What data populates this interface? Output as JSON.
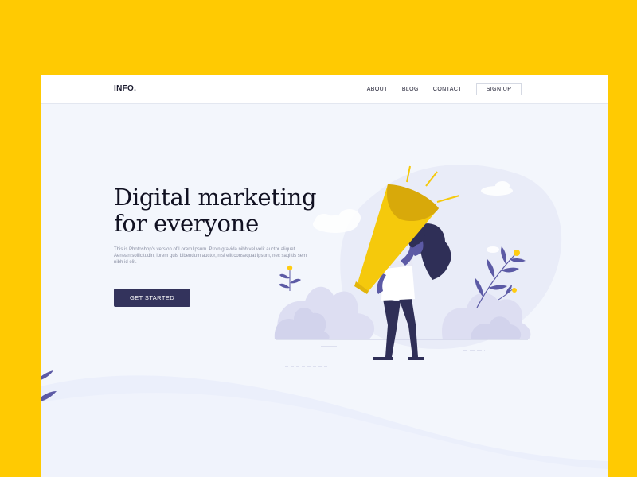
{
  "nav": {
    "logo": "INFO.",
    "links": [
      {
        "label": "ABOUT"
      },
      {
        "label": "BLOG"
      },
      {
        "label": "CONTACT"
      }
    ],
    "signup_label": "SIGN UP"
  },
  "hero": {
    "title_line1": "Digital marketing",
    "title_line2": "for everyone",
    "description": "This is Photoshop's version of Lorem Ipsum. Proin gravida nibh vel velit auctor aliquet. Aenean sollicitudin, lorem quis bibendum auctor, nisi elit consequat ipsum, nec sagittis sem nibh id elit.",
    "cta_label": "GET STARTED"
  },
  "colors": {
    "background": "#FFCA02",
    "page": "#F3F6FC",
    "accent_dark": "#33335C",
    "megaphone": "#F5C90C",
    "plant_purple": "#5C5AA5",
    "flower_yellow": "#FFCC12"
  },
  "illustration": {
    "subject": "woman-holding-megaphone",
    "decor": [
      "cloud",
      "bush",
      "plant-leaf",
      "flower"
    ]
  }
}
